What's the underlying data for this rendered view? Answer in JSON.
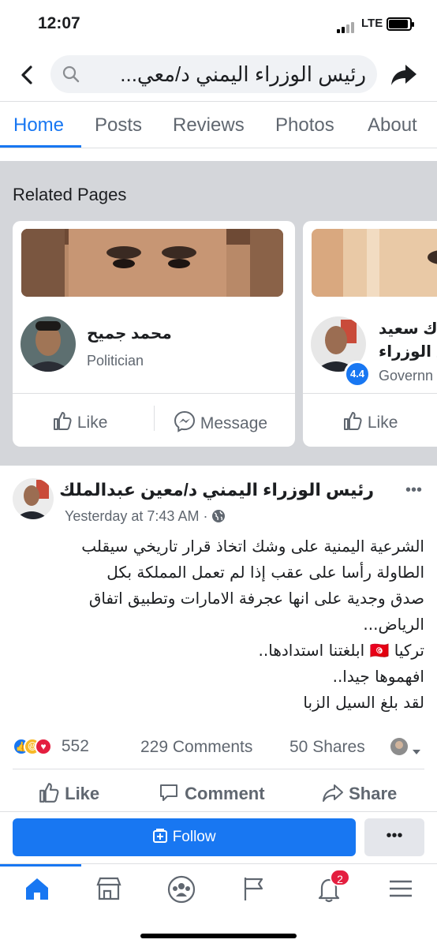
{
  "status": {
    "time": "12:07",
    "network": "LTE"
  },
  "search": {
    "query": "رئيس الوزراء اليمني د/معي..."
  },
  "tabs": [
    "Home",
    "Posts",
    "Reviews",
    "Photos",
    "About"
  ],
  "related": {
    "heading": "Related Pages",
    "cards": [
      {
        "name": "محمد جميح",
        "category": "Politician",
        "like_label": "Like",
        "message_label": "Message"
      },
      {
        "name_line1": "ك سعيد",
        "name_line2": "س الوزراء",
        "category": "Governn",
        "rating": "4.4",
        "like_label": "Like"
      }
    ]
  },
  "post": {
    "author": "رئيس الوزراء اليمني د/معين عبدالملك",
    "time": "Yesterday at 7:43 AM",
    "separator": "·",
    "more": "•••",
    "body_lines": [
      "الشرعية اليمنية على وشك اتخاذ قرار تاريخي سيقلب",
      "الطاولة رأسا على عقب إذا لم تعمل المملكة بكل",
      "صدق وجدية على انها عجرفة الامارات وتطبيق اتفاق",
      "الرياض...",
      "تركيا 🇹🇳 ابلغتنا استدادها..",
      "افهموها جيدا..",
      "لقد بلغ السيل الزبا"
    ],
    "reactions_count": "552",
    "comments": "229 Comments",
    "shares": "50 Shares",
    "actions": {
      "like": "Like",
      "comment": "Comment",
      "share": "Share"
    }
  },
  "follow": {
    "label": "Follow",
    "more": "•••"
  },
  "nav": {
    "notifications_badge": "2"
  },
  "colors": {
    "accent": "#1877f2",
    "badge": "#e41e3f",
    "gray_bg": "#d4d6da"
  }
}
